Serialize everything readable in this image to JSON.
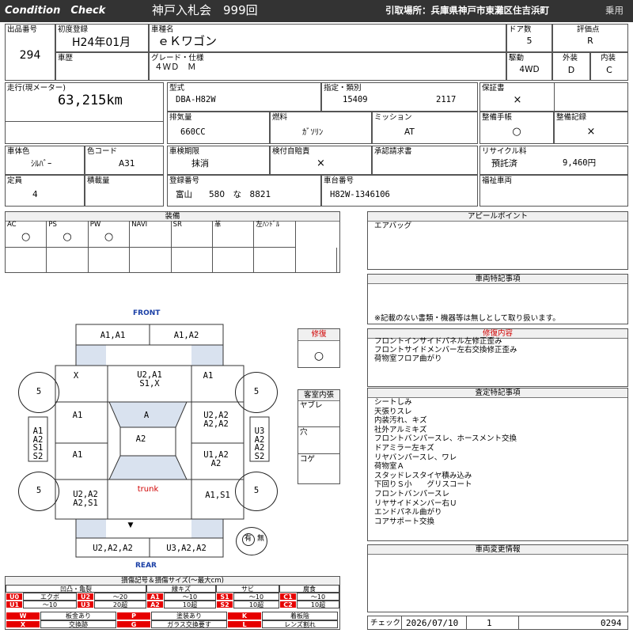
{
  "header": {
    "brand": "Condition　Check",
    "auction": "神戸入札会　999回",
    "pickup": "引取場所：兵庫県神戸市東灘区住吉浜町",
    "category": "乗用"
  },
  "labels": {
    "lot_no": "出品番号",
    "first_reg": "初度登録",
    "car_name": "車種名",
    "doors": "ドア数",
    "rating": "評価点",
    "history": "車歴",
    "grade": "グレード・仕様",
    "drive": "駆動",
    "exterior": "外装",
    "interior": "内装",
    "mileage": "走行(現メーター)",
    "model": "型式",
    "designation": "指定・類別",
    "warranty": "保証書",
    "displacement": "排気量",
    "fuel": "燃料",
    "mission": "ミッション",
    "maintenance_book": "整備手帳",
    "maintenance_record": "整備記録",
    "color": "車体色",
    "color_code": "色コード",
    "inspection": "車検期限",
    "liability": "検付自賠責",
    "approval_claim": "承認請求書",
    "recycle_fee": "リサイクル料",
    "capacity": "定員",
    "load": "積載量",
    "plate": "登録番号",
    "chassis": "車台番号",
    "welfare": "福祉車両"
  },
  "vehicle": {
    "lot_no": "294",
    "first_reg": "H24年01月",
    "car_name": "ｅＫワゴン",
    "doors": "5",
    "rating": "R",
    "grade": "４ＷＤ　Ｍ",
    "drive": "4WD",
    "exterior": "D",
    "interior": "C",
    "mileage": "63,215km",
    "model": "DBA-H82W",
    "designation": "15409",
    "classification": "2117",
    "warranty": "×",
    "displacement": "660CC",
    "fuel": "ｶﾞｿﾘﾝ",
    "mission": "AT",
    "maintenance_book": "○",
    "maintenance_record": "×",
    "color": "ｼﾙﾊﾞｰ",
    "color_code": "A31",
    "inspection": "抹消",
    "liability": "×",
    "recycle_status": "預託済",
    "recycle_amount": "9,460円",
    "capacity": "4",
    "plate": "富山　　580　な　8821",
    "chassis": "H82W-1346106"
  },
  "equipment": {
    "title": "装備",
    "items": [
      {
        "label": "AC",
        "mark": "○"
      },
      {
        "label": "PS",
        "mark": "○"
      },
      {
        "label": "PW",
        "mark": "○"
      },
      {
        "label": "NAVI",
        "mark": ""
      },
      {
        "label": "SR",
        "mark": ""
      },
      {
        "label": "革",
        "mark": ""
      },
      {
        "label": "左ﾊﾝﾄﾞﾙ",
        "mark": ""
      }
    ]
  },
  "panels": {
    "appeal_title": "アピールポイント",
    "appeal_text": "エアバッグ",
    "special_title": "車両特記事項",
    "special_note": "※記載のない書類・機器等は無しとして取り扱います。",
    "repair_title": "修復内容",
    "repair_items": [
      "フロントインサイドパネル左修正歪み",
      "フロントサイドメンバー左右交換修正歪み",
      "荷物室フロア曲がり"
    ],
    "inspection_title": "査定特記事項",
    "inspection_items": [
      "シートしみ",
      "天張りスレ",
      "内装汚れ、キズ",
      "社外アルミキズ",
      "フロントバンパースレ、ホースメント交換",
      "ドアミラー左キズ",
      "リヤバンパースレ、ワレ",
      "荷物室Ａ",
      "スタッドレスタイヤ積み込み",
      "下回りＳ小　　グリスコート",
      "フロントバンパースレ",
      "リヤサイドメンバー右Ｕ",
      "エンドパネル曲がり",
      "コアサポート交換"
    ],
    "change_title": "車両変更情報"
  },
  "check": {
    "label": "チェック",
    "date": "2026/07/10",
    "count": "1",
    "number": "0294"
  },
  "repair_box": {
    "title": "修復",
    "mark": "○"
  },
  "cabin": {
    "title": "客室内張",
    "rows": [
      "ヤブレ",
      "穴",
      "コゲ"
    ]
  },
  "diagram": {
    "front": "FRONT",
    "rear": "REAR",
    "trunk": "trunk",
    "wheel_value": "5",
    "front_panel_left": "A1,A1",
    "front_panel_right": "A1,A2",
    "hood_left": "X",
    "hood_center": "U2,A1\nS1,X",
    "hood_right": "A1",
    "windshield": "A",
    "roof": "A2",
    "door_fl": "A1",
    "door_fr": "U2,A2\nA2,A2",
    "door_rl": "A1",
    "door_rr": "U1,A2\nA2",
    "rear_left": "U2,A2\nA2,S1",
    "rear_right": "A1,S1",
    "rear_panel_left": "U2,A2,A2",
    "rear_panel_right": "U3,A2,A2",
    "side_left": "A1\nA2\nS1\nS2",
    "side_right": "U3\nA2\nA2\nS2",
    "rear_mark": "▼",
    "spare_mark": "有",
    "spare_label": "無"
  },
  "legend": {
    "title": "損傷記号＆損傷サイズ(〜最大cm)",
    "groups": [
      "凹凸・亀裂",
      "線キズ",
      "サビ",
      "腐食"
    ],
    "row1": [
      {
        "code": "U0",
        "text": "エクボ"
      },
      {
        "code": "U2",
        "text": "〜20"
      },
      {
        "code": "A1",
        "text": "〜10"
      },
      {
        "code": "S1",
        "text": "〜10"
      },
      {
        "code": "C1",
        "text": "〜10"
      }
    ],
    "row2": [
      {
        "code": "U1",
        "text": "〜10"
      },
      {
        "code": "U3",
        "text": "20超"
      },
      {
        "code": "A2",
        "text": "10超"
      },
      {
        "code": "S2",
        "text": "10超"
      },
      {
        "code": "C2",
        "text": "10超"
      }
    ],
    "marks": [
      {
        "code": "W",
        "text": "板金あり"
      },
      {
        "code": "P",
        "text": "塗装あり"
      },
      {
        "code": "K",
        "text": "着板陰"
      },
      {
        "code": "X",
        "text": "交換跡"
      },
      {
        "code": "G",
        "text": "ガラス交換要す"
      },
      {
        "code": "L",
        "text": "レンズ割れ"
      }
    ]
  }
}
